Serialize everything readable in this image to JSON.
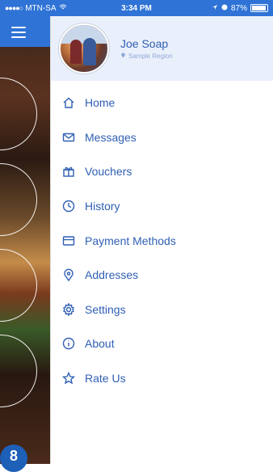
{
  "status_bar": {
    "carrier": "MTN-SA",
    "time": "3:34 PM",
    "battery": "87%"
  },
  "user": {
    "name": "Joe Soap",
    "location": "Sample Region"
  },
  "menu": [
    {
      "label": "Home",
      "icon": "home-icon"
    },
    {
      "label": "Messages",
      "icon": "envelope-icon"
    },
    {
      "label": "Vouchers",
      "icon": "gift-icon"
    },
    {
      "label": "History",
      "icon": "clock-icon"
    },
    {
      "label": "Payment Methods",
      "icon": "credit-card-icon"
    },
    {
      "label": "Addresses",
      "icon": "location-pin-icon"
    },
    {
      "label": "Settings",
      "icon": "gear-icon"
    },
    {
      "label": "About",
      "icon": "info-icon"
    },
    {
      "label": "Rate Us",
      "icon": "star-icon"
    }
  ],
  "figure_badge": "8",
  "colors": {
    "accent": "#2f73d6",
    "menu_text": "#2f5fb3",
    "header_bg": "#eaf0fb"
  }
}
